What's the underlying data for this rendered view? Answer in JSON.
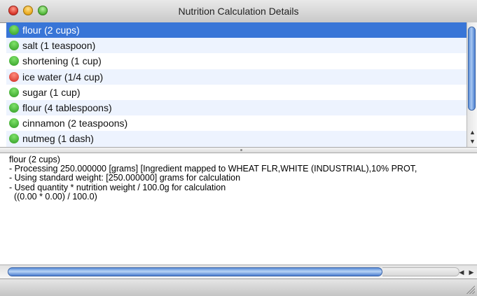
{
  "window": {
    "title": "Nutrition Calculation Details"
  },
  "ingredients": [
    {
      "label": "flour (2 cups)",
      "status": "ok",
      "selected": true
    },
    {
      "label": "salt (1 teaspoon)",
      "status": "ok"
    },
    {
      "label": "shortening (1 cup)",
      "status": "ok"
    },
    {
      "label": "ice water (1/4 cup)",
      "status": "error"
    },
    {
      "label": "sugar (1 cup)",
      "status": "ok"
    },
    {
      "label": "flour (4 tablespoons)",
      "status": "ok"
    },
    {
      "label": "cinnamon (2 teaspoons)",
      "status": "ok"
    },
    {
      "label": "nutmeg (1 dash)",
      "status": "ok"
    }
  ],
  "details": {
    "lines": [
      "flour (2 cups)",
      "- Processing 250.000000 [grams] [Ingredient mapped to WHEAT FLR,WHITE (INDUSTRIAL),10% PROT,",
      "- Using standard weight: [250.000000] grams for calculation",
      "- Used quantity * nutrition weight / 100.0g for calculation",
      "  ((0.00 * 0.00) / 100.0)"
    ]
  },
  "icons": {
    "ok": "check-circle-icon",
    "error": "minus-circle-icon"
  },
  "colors": {
    "selection": "#3875d7",
    "alt_row": "#edf3fe",
    "ok": "#2f9a22",
    "error": "#cf2b22"
  }
}
